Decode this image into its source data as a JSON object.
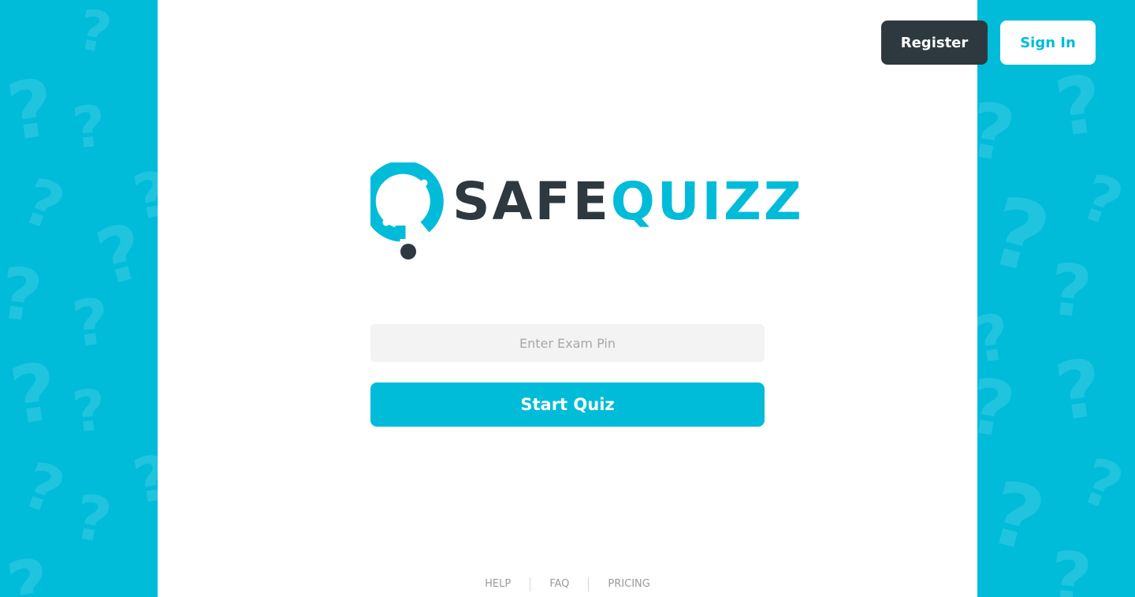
{
  "header": {
    "register_label": "Register",
    "signin_label": "Sign In"
  },
  "logo": {
    "icon": "safequizz-logo-icon",
    "text_dark": "SAFE",
    "text_accent": "QUIZZ"
  },
  "exam": {
    "pin_placeholder": "Enter Exam Pin",
    "pin_value": "",
    "start_label": "Start Quiz"
  },
  "footer": {
    "links": [
      {
        "label": "HELP"
      },
      {
        "label": "FAQ"
      },
      {
        "label": "PRICING"
      }
    ]
  },
  "background": {
    "pattern_icon": "question-mark-icon",
    "pattern_glyph": "?"
  },
  "colors": {
    "accent": "#00bcd9",
    "dark": "#2e393f",
    "input_bg": "#f3f3f3",
    "footer_text": "#9a9a9a"
  }
}
